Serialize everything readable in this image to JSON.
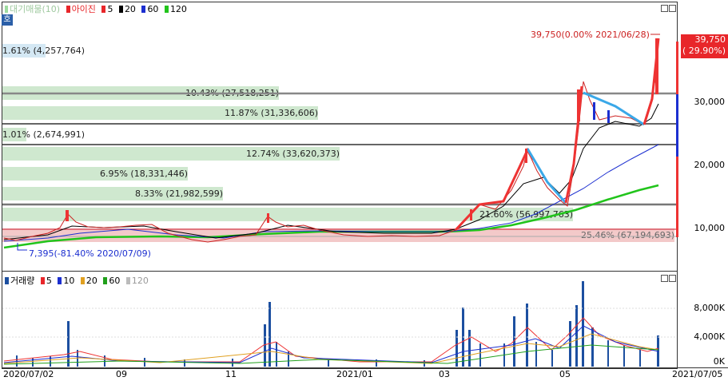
{
  "upper_panel": {
    "legend": {
      "volume_profile_label": "대기매물(10)",
      "stock_label": "아이진",
      "ma_labels": [
        "5",
        "20",
        "60",
        "120"
      ],
      "ma_colors": [
        "#e8262a",
        "#000000",
        "#1c2fd0",
        "#21c41b"
      ]
    },
    "corner_badge": "호",
    "price_axis": [
      "30,000",
      "20,000",
      "10,000"
    ],
    "current_price": "39,750",
    "current_change": "( 29.90%)",
    "high_annotation": "39,750(0.00% 2021/06/28)",
    "low_annotation": "7,395(-81.40% 2020/07/09)",
    "volume_profile": [
      {
        "label": "1.61% (4,257,764)",
        "share": 1.61
      },
      {
        "label": "10.43% (27,518,251)",
        "share": 10.43
      },
      {
        "label": "11.87% (31,336,606)",
        "share": 11.87
      },
      {
        "label": "1.01% (2,674,991)",
        "share": 1.01
      },
      {
        "label": "12.74% (33,620,373)",
        "share": 12.74
      },
      {
        "label": "6.95% (18,331,446)",
        "share": 6.95
      },
      {
        "label": "8.33% (21,982,599)",
        "share": 8.33
      },
      {
        "label": "21.60% (56,997,763)",
        "share": 21.6
      },
      {
        "label": "25.46% (67,194,693)",
        "share": 25.46
      }
    ]
  },
  "lower_panel": {
    "legend": {
      "title": "거래량",
      "ma_labels": [
        "5",
        "10",
        "20",
        "60",
        "120"
      ],
      "ma_colors": [
        "#e8262a",
        "#1c2fd0",
        "#e0a020",
        "#21a01b",
        "#bbbbbb"
      ]
    },
    "volume_axis": [
      "8,000K",
      "4,000K",
      "0K"
    ]
  },
  "x_axis": {
    "ticks": [
      "2020/07/02",
      "09",
      "11",
      "2021/01",
      "03",
      "05"
    ],
    "end_date": "2021/07/05"
  },
  "chart_data": {
    "type": "candlestick",
    "price_ylim": [
      5000,
      41000
    ],
    "volume_ylim": [
      0,
      10000
    ],
    "volume_unit": "K",
    "monthly_close_estimates": [
      {
        "date": "2020/07",
        "close": 8000
      },
      {
        "date": "2020/08",
        "close": 11500
      },
      {
        "date": "2020/09",
        "close": 10500
      },
      {
        "date": "2020/10",
        "close": 8500
      },
      {
        "date": "2020/11",
        "close": 9500
      },
      {
        "date": "2020/12",
        "close": 9000
      },
      {
        "date": "2021/01",
        "close": 8500
      },
      {
        "date": "2021/02",
        "close": 8700
      },
      {
        "date": "2021/03",
        "close": 12000
      },
      {
        "date": "2021/04",
        "close": 21000
      },
      {
        "date": "2021/05",
        "close": 30000
      },
      {
        "date": "2021/06",
        "close": 39750
      }
    ],
    "horizontal_levels": [
      31500,
      26500,
      23000,
      13500,
      9500
    ]
  }
}
